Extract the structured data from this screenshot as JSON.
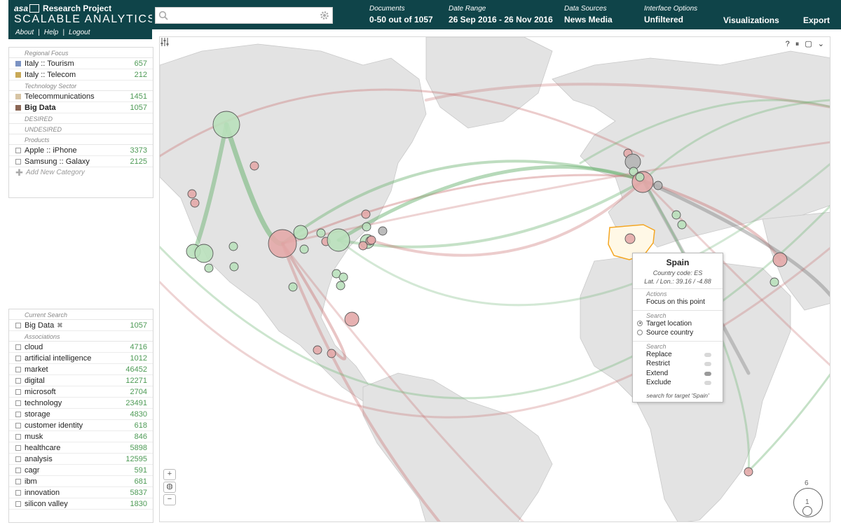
{
  "app": {
    "brand_mark": "asa",
    "title_line1": "Research Project",
    "title_line2": "SCALABLE ANALYTICS",
    "links": [
      "About",
      "Help",
      "Logout"
    ]
  },
  "search": {
    "placeholder": "",
    "value": ""
  },
  "header_items": [
    {
      "label": "Documents",
      "value": "0-50 out of 1057"
    },
    {
      "label": "Date Range",
      "value": "26 Sep 2016 - 26 Nov 2016"
    },
    {
      "label": "Data Sources",
      "value": "News Media"
    },
    {
      "label": "Interface Options",
      "value": "Unfiltered"
    }
  ],
  "header_buttons": {
    "visualizations": "Visualizations",
    "export": "Export"
  },
  "filters": {
    "regional_title": "Regional Focus",
    "regional": [
      {
        "label": "Italy :: Tourism",
        "count": "657",
        "color": "#7b93c3"
      },
      {
        "label": "Italy :: Telecom",
        "count": "212",
        "color": "#c9a957"
      }
    ],
    "sector_title": "Technology Sector",
    "sector": [
      {
        "label": "Telecommunications",
        "count": "1451",
        "color": "#d7c4a4"
      },
      {
        "label": "Big Data",
        "count": "1057",
        "color": "#8b6655"
      }
    ],
    "desired_title": "DESIRED",
    "undesired_title": "UNDESIRED",
    "products_title": "Products",
    "products": [
      {
        "label": "Apple :: iPhone",
        "count": "3373"
      },
      {
        "label": "Samsung :: Galaxy",
        "count": "2125"
      }
    ],
    "add_category": "Add New Category"
  },
  "current_search": {
    "title": "Current Search",
    "item": {
      "label": "Big Data",
      "count": "1057"
    },
    "associations_title": "Associations",
    "associations": [
      {
        "label": "cloud",
        "count": "4716"
      },
      {
        "label": "artificial intelligence",
        "count": "1012"
      },
      {
        "label": "market",
        "count": "46452"
      },
      {
        "label": "digital",
        "count": "12271"
      },
      {
        "label": "microsoft",
        "count": "2704"
      },
      {
        "label": "technology",
        "count": "23491"
      },
      {
        "label": "storage",
        "count": "4830"
      },
      {
        "label": "customer identity",
        "count": "618"
      },
      {
        "label": "musk",
        "count": "846"
      },
      {
        "label": "healthcare",
        "count": "5898"
      },
      {
        "label": "analysis",
        "count": "12595"
      },
      {
        "label": "cagr",
        "count": "591"
      },
      {
        "label": "ibm",
        "count": "681"
      },
      {
        "label": "innovation",
        "count": "5837"
      },
      {
        "label": "silicon valley",
        "count": "1830"
      }
    ]
  },
  "map": {
    "controls": [
      "?",
      "⏸",
      "▢",
      "⌄"
    ],
    "zoom": [
      "+",
      "◍",
      "−"
    ],
    "scale_top": "6",
    "scale_inner": "1"
  },
  "popup": {
    "title": "Spain",
    "country_code_label": "Country code:",
    "country_code": "ES",
    "latlon_label": "Lat. / Lon.:",
    "latlon": "39.16 / -4.88",
    "actions_title": "Actions",
    "focus": "Focus on this point",
    "search_title": "Search",
    "target": "Target location",
    "source": "Source country",
    "search2_title": "Search",
    "replace": "Replace",
    "restrict": "Restrict",
    "extend": "Extend",
    "exclude": "Exclude",
    "footer_prefix": "search for target ",
    "footer_target": "'Spain'"
  },
  "colors": {
    "brand": "#0f4449",
    "count_green": "#4d9a55",
    "node_green": "#b9e0bb",
    "node_red": "#e3a8a8",
    "node_gray": "#b4b4b4",
    "highlight": "#f4a623"
  }
}
